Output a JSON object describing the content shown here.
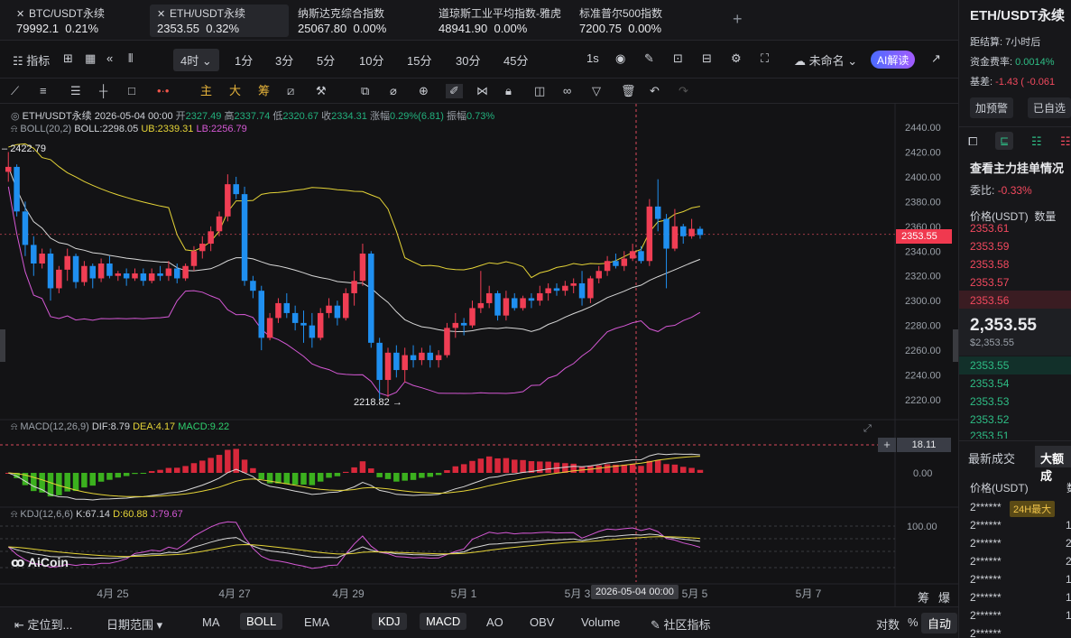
{
  "tickers": [
    {
      "name": "BTC/USDT永续",
      "price": "79992.1",
      "change": "0.21%",
      "active": false
    },
    {
      "name": "ETH/USDT永续",
      "price": "2353.55",
      "change": "0.32%",
      "active": true
    },
    {
      "name": "纳斯达克综合指数",
      "price": "25067.80",
      "change": "0.00%",
      "active": false
    },
    {
      "name": "道琼斯工业平均指数-雅虎",
      "price": "48941.90",
      "change": "0.00%",
      "active": false
    },
    {
      "name": "标准普尔500指数",
      "price": "7200.75",
      "change": "0.00%",
      "active": false
    }
  ],
  "add_tab": "+",
  "toolbar": {
    "indicators": "指标",
    "interval": "4时",
    "periods": [
      "1分",
      "3分",
      "5分",
      "10分",
      "15分",
      "30分",
      "45分"
    ],
    "second": "1s",
    "layout_name": "未命名",
    "ai": "AI解读"
  },
  "drawtools": {
    "main": "主",
    "bull": "大",
    "chip": "筹"
  },
  "ohlc": {
    "symbol": "ETH/USDT永续",
    "datetime": "2026-05-04 00:00",
    "open_label": "开",
    "open": "2327.49",
    "high_label": "高",
    "high": "2337.74",
    "low_label": "低",
    "low": "2320.67",
    "close_label": "收",
    "close": "2334.31",
    "chg_label": "涨幅",
    "chg": "0.29%(6.81)",
    "amp_label": "振幅",
    "amp": "0.73%"
  },
  "boll": {
    "name": "BOLL(20,2)",
    "boll": "BOLL:2298.05",
    "ub": "UB:2339.31",
    "lb": "LB:2256.79"
  },
  "macd": {
    "name": "MACD(12,26,9)",
    "dif": "DIF:8.79",
    "dea": "DEA:4.17",
    "macd": "MACD:9.22"
  },
  "kdj": {
    "name": "KDJ(12,6,6)",
    "k": "K:67.14",
    "d": "D:60.88",
    "j": "J:79.67"
  },
  "markers": {
    "high": "2422.79",
    "low": "2218.82"
  },
  "price_axis": [
    "2440.00",
    "2420.00",
    "2400.00",
    "2380.00",
    "2360.00",
    "2340.00",
    "2320.00",
    "2300.00",
    "2280.00",
    "2260.00",
    "2240.00",
    "2220.00"
  ],
  "current_price": "2353.55",
  "macd_axis": [
    "18.11",
    "0.00"
  ],
  "kdj_axis": [
    "100.00"
  ],
  "date_axis": [
    "4月 25",
    "4月 27",
    "4月 29",
    "5月 1",
    "5月 3",
    "5月 5",
    "5月 7"
  ],
  "crosshair_date": "2026-05-04 00:00",
  "corner_labels": {
    "left": "筹",
    "right": "爆"
  },
  "watermark": "AiCoin",
  "chart_data": {
    "type": "candlestick",
    "interval": "4h",
    "ylim": [
      2210,
      2445
    ],
    "colors": {
      "up": "#f03e54",
      "down": "#1f8ff0"
    },
    "candles": [
      [
        2404,
        2420,
        2396,
        2408
      ],
      [
        2408,
        2410,
        2368,
        2372
      ],
      [
        2372,
        2380,
        2336,
        2345
      ],
      [
        2345,
        2352,
        2320,
        2330
      ],
      [
        2330,
        2342,
        2326,
        2338
      ],
      [
        2338,
        2342,
        2300,
        2310
      ],
      [
        2310,
        2328,
        2306,
        2325
      ],
      [
        2325,
        2342,
        2316,
        2336
      ],
      [
        2336,
        2338,
        2310,
        2315
      ],
      [
        2315,
        2332,
        2312,
        2328
      ],
      [
        2328,
        2330,
        2310,
        2318
      ],
      [
        2318,
        2334,
        2315,
        2330
      ],
      [
        2330,
        2336,
        2318,
        2320
      ],
      [
        2320,
        2324,
        2316,
        2322
      ],
      [
        2322,
        2326,
        2312,
        2318
      ],
      [
        2318,
        2326,
        2316,
        2322
      ],
      [
        2322,
        2326,
        2312,
        2316
      ],
      [
        2316,
        2326,
        2314,
        2322
      ],
      [
        2322,
        2328,
        2316,
        2320
      ],
      [
        2320,
        2332,
        2316,
        2326
      ],
      [
        2326,
        2330,
        2314,
        2318
      ],
      [
        2318,
        2330,
        2316,
        2328
      ],
      [
        2328,
        2344,
        2324,
        2340
      ],
      [
        2340,
        2352,
        2334,
        2346
      ],
      [
        2346,
        2360,
        2340,
        2356
      ],
      [
        2356,
        2372,
        2352,
        2368
      ],
      [
        2368,
        2402,
        2364,
        2394
      ],
      [
        2394,
        2400,
        2382,
        2386
      ],
      [
        2386,
        2392,
        2312,
        2316
      ],
      [
        2316,
        2320,
        2302,
        2308
      ],
      [
        2308,
        2312,
        2260,
        2270
      ],
      [
        2270,
        2290,
        2268,
        2286
      ],
      [
        2286,
        2302,
        2282,
        2298
      ],
      [
        2298,
        2306,
        2286,
        2290
      ],
      [
        2290,
        2296,
        2276,
        2282
      ],
      [
        2282,
        2292,
        2266,
        2280
      ],
      [
        2280,
        2290,
        2262,
        2270
      ],
      [
        2270,
        2294,
        2268,
        2290
      ],
      [
        2290,
        2302,
        2286,
        2296
      ],
      [
        2296,
        2300,
        2280,
        2286
      ],
      [
        2286,
        2310,
        2284,
        2306
      ],
      [
        2306,
        2324,
        2296,
        2316
      ],
      [
        2316,
        2346,
        2312,
        2338
      ],
      [
        2338,
        2340,
        2262,
        2266
      ],
      [
        2266,
        2270,
        2220,
        2236
      ],
      [
        2236,
        2262,
        2222,
        2258
      ],
      [
        2258,
        2264,
        2238,
        2244
      ],
      [
        2244,
        2262,
        2234,
        2256
      ],
      [
        2256,
        2264,
        2246,
        2252
      ],
      [
        2252,
        2262,
        2248,
        2258
      ],
      [
        2258,
        2264,
        2246,
        2252
      ],
      [
        2252,
        2260,
        2246,
        2256
      ],
      [
        2256,
        2282,
        2254,
        2278
      ],
      [
        2278,
        2290,
        2270,
        2282
      ],
      [
        2282,
        2286,
        2272,
        2280
      ],
      [
        2280,
        2300,
        2278,
        2294
      ],
      [
        2294,
        2324,
        2290,
        2298
      ],
      [
        2298,
        2312,
        2294,
        2306
      ],
      [
        2306,
        2308,
        2284,
        2288
      ],
      [
        2288,
        2308,
        2284,
        2302
      ],
      [
        2302,
        2306,
        2292,
        2294
      ],
      [
        2294,
        2304,
        2292,
        2302
      ],
      [
        2302,
        2306,
        2294,
        2300
      ],
      [
        2300,
        2312,
        2296,
        2306
      ],
      [
        2306,
        2314,
        2300,
        2310
      ],
      [
        2310,
        2314,
        2304,
        2308
      ],
      [
        2308,
        2316,
        2304,
        2312
      ],
      [
        2312,
        2318,
        2306,
        2314
      ],
      [
        2314,
        2324,
        2296,
        2302
      ],
      [
        2302,
        2320,
        2298,
        2318
      ],
      [
        2318,
        2328,
        2314,
        2324
      ],
      [
        2324,
        2336,
        2320,
        2332
      ],
      [
        2332,
        2338,
        2326,
        2328
      ],
      [
        2328,
        2340,
        2324,
        2334
      ],
      [
        2334,
        2346,
        2332,
        2340
      ],
      [
        2340,
        2344,
        2330,
        2332
      ],
      [
        2332,
        2382,
        2328,
        2376
      ],
      [
        2376,
        2398,
        2356,
        2366
      ],
      [
        2366,
        2370,
        2310,
        2342
      ],
      [
        2342,
        2374,
        2340,
        2360
      ],
      [
        2360,
        2362,
        2346,
        2352
      ],
      [
        2352,
        2366,
        2350,
        2358
      ],
      [
        2358,
        2360,
        2350,
        2353
      ]
    ]
  },
  "right": {
    "title": "ETH/USDT永续",
    "settle_label": "距结算:",
    "settle": "7小时后",
    "funding_label": "资金费率:",
    "funding": "0.0014%",
    "basis_label": "基差:",
    "basis": "-1.43 ( -0.061",
    "alert_btn": "加预警",
    "fav_btn": "已自选",
    "depth_title": "查看主力挂单情况",
    "wb_label": "委比:",
    "wb": "-0.33%",
    "col_price": "价格(USDT)",
    "col_qty": "数量",
    "asks": [
      "2353.61",
      "2353.59",
      "2353.58",
      "2353.57",
      "2353.56"
    ],
    "last": "2,353.55",
    "last_usd": "$2,353.55",
    "bids": [
      "2353.55",
      "2353.54",
      "2353.53",
      "2353.52",
      "2353.51"
    ],
    "trades_tab": "最新成交",
    "big_tab": "大额成",
    "trades_col": "价格(USDT)",
    "trades_col2": "数",
    "trades": [
      "2******",
      "2******",
      "2******",
      "2******",
      "2******",
      "2******",
      "2******",
      "2******"
    ],
    "trades_qty": [
      "",
      "1",
      "2",
      "2",
      "1",
      "1",
      "1",
      ""
    ],
    "badge": "24H最大"
  },
  "bottom": {
    "locate": "定位到...",
    "range": "日期范围",
    "inds": [
      "MA",
      "BOLL",
      "EMA"
    ],
    "subinds": [
      "KDJ",
      "MACD",
      "AO",
      "OBV",
      "Volume"
    ],
    "community": "社区指标",
    "log": "对数",
    "pct": "%",
    "auto": "自动"
  }
}
